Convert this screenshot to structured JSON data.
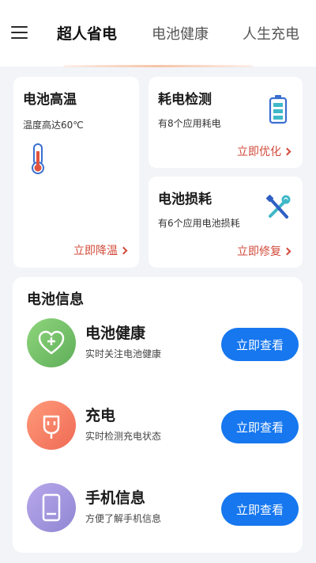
{
  "header": {
    "tabs": [
      {
        "label": "超人省电"
      },
      {
        "label": "电池健康"
      },
      {
        "label": "人生充电"
      }
    ]
  },
  "cards": {
    "high_temp": {
      "title": "电池高温",
      "desc": "温度高达60℃",
      "action": "立即降温"
    },
    "power_check": {
      "title": "耗电检测",
      "desc": "有8个应用耗电",
      "action": "立即优化"
    },
    "battery_wear": {
      "title": "电池损耗",
      "desc": "有6个应用电池损耗",
      "action": "立即修复"
    }
  },
  "battery_info": {
    "title": "电池信息",
    "items": [
      {
        "name": "电池健康",
        "desc": "实时关注电池健康",
        "button": "立即查看",
        "color": "#6cc06a"
      },
      {
        "name": "充电",
        "desc": "实时检测充电状态",
        "button": "立即查看",
        "color": "#f47e62"
      },
      {
        "name": "手机信息",
        "desc": "方便了解手机信息",
        "button": "立即查看",
        "color": "#9a8fd6"
      }
    ]
  },
  "colors": {
    "accent_blue": "#1677ef",
    "action_red": "#d24a3a"
  }
}
